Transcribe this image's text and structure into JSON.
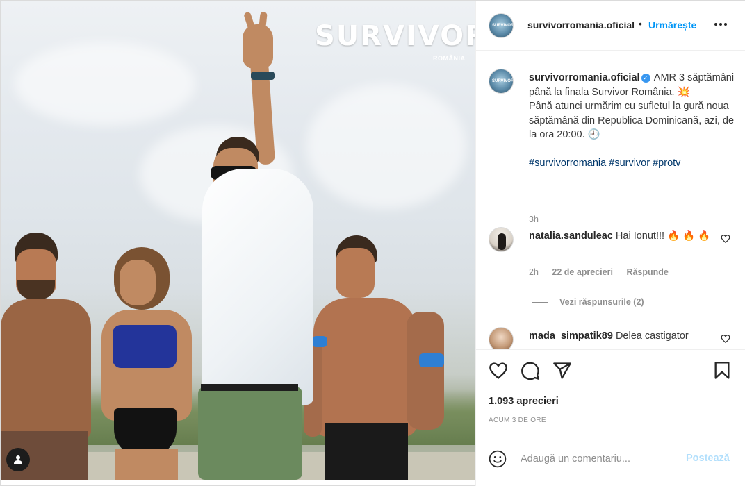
{
  "post": {
    "logo_text": "SURVIVOR",
    "logo_sub": "ROMÂNIA"
  },
  "header": {
    "username": "survivorromania.oficial",
    "separator": "•",
    "follow_label": "Urmărește",
    "more_icon": "more-horizontal-icon"
  },
  "caption": {
    "username": "survivorromania.oficial",
    "text_line1": "AMR 3 săptămâni până la finala Survivor România. 💥",
    "text_line2": "Până atunci urmărim cu sufletul la gură noua săptămână din Republica Dominicană, azi, de la ora 20:00. 🕘",
    "hashtags": [
      "#survivorromania",
      "#survivor",
      "#protv"
    ],
    "time": "3h"
  },
  "comments": [
    {
      "username": "natalia.sanduleac",
      "text": "Hai Ionut!!! 🔥 🔥 🔥",
      "time": "2h",
      "likes": "22 de aprecieri",
      "reply_label": "Răspunde",
      "view_replies": "Vezi răspunsurile (2)"
    },
    {
      "username": "mada_simpatik89",
      "text": "Delea castigator"
    }
  ],
  "actions": {
    "likes_count": "1.093 aprecieri",
    "posted": "ACUM 3 DE ORE"
  },
  "add_comment": {
    "placeholder": "Adaugă un comentariu...",
    "post_label": "Postează"
  },
  "colors": {
    "accent": "#0095f6",
    "post_disabled": "#b2dffc",
    "muted": "#8e8e8e",
    "hashtag": "#00376b"
  }
}
